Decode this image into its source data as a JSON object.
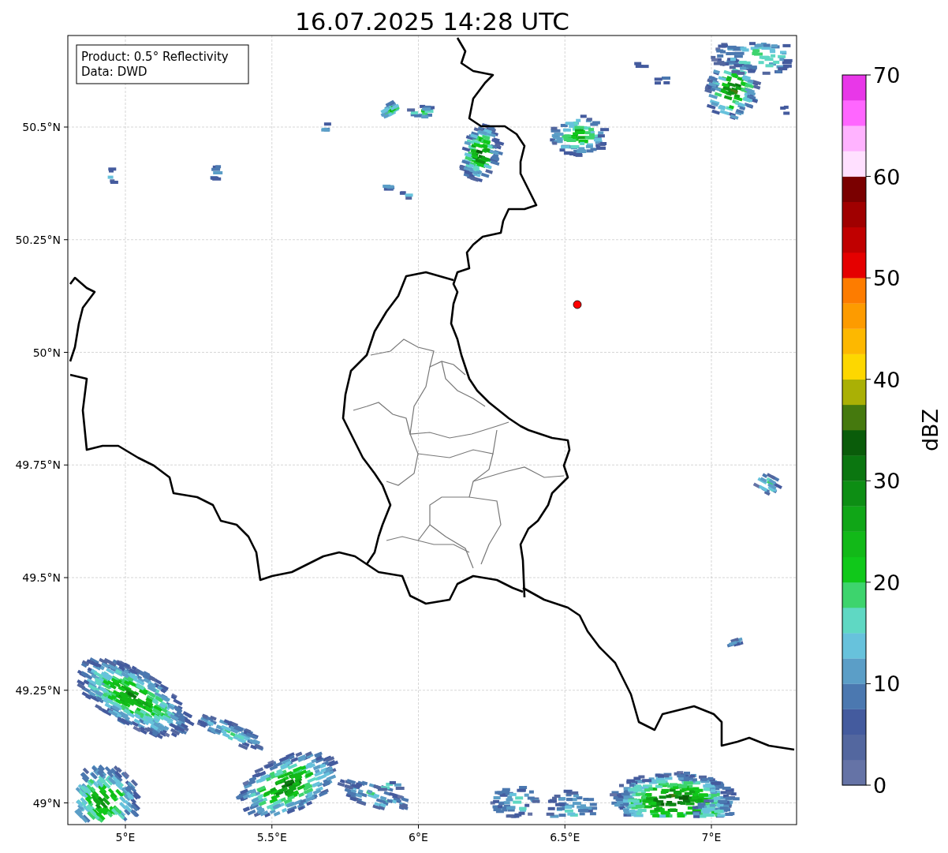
{
  "title": "16.07.2025 14:28 UTC",
  "legend": [
    "Product: 0.5° Reflectivity",
    "Data: DWD"
  ],
  "map": {
    "yticks": [
      "50.5°N",
      "50.25°N",
      "50°N",
      "49.75°N",
      "49.5°N",
      "49.25°N",
      "49°N"
    ],
    "xticks": [
      "5°E",
      "5.5°E",
      "6°E",
      "6.5°E",
      "7°E"
    ]
  },
  "colorbar": {
    "label": "dBZ",
    "ticks": [
      "70",
      "60",
      "50",
      "40",
      "30",
      "20",
      "10",
      "0"
    ],
    "levels": [
      {
        "color": "#6573a6"
      },
      {
        "color": "#53679f"
      },
      {
        "color": "#445b9e"
      },
      {
        "color": "#4b78b0"
      },
      {
        "color": "#5b9ec7"
      },
      {
        "color": "#67c2dc"
      },
      {
        "color": "#5fd8c3"
      },
      {
        "color": "#3dd46d"
      },
      {
        "color": "#10c81a"
      },
      {
        "color": "#12b918"
      },
      {
        "color": "#10a617"
      },
      {
        "color": "#0d8e14"
      },
      {
        "color": "#0b7610"
      },
      {
        "color": "#0a5c0a"
      },
      {
        "color": "#45790e"
      },
      {
        "color": "#aab005"
      },
      {
        "color": "#fdd700"
      },
      {
        "color": "#fdb800"
      },
      {
        "color": "#fd9b00"
      },
      {
        "color": "#fd7c00"
      },
      {
        "color": "#e50000"
      },
      {
        "color": "#c00000"
      },
      {
        "color": "#a00000"
      },
      {
        "color": "#7a0000"
      },
      {
        "color": "#ffe0ff"
      },
      {
        "color": "#ffb3ff"
      },
      {
        "color": "#ff66ff"
      },
      {
        "color": "#e837e8"
      }
    ]
  }
}
